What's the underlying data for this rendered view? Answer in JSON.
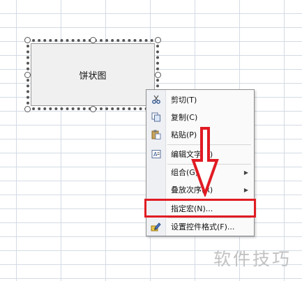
{
  "shape": {
    "label": "饼状图"
  },
  "context_menu": {
    "items": [
      {
        "label": "剪切(T)",
        "icon": "scissors-icon"
      },
      {
        "label": "复制(C)",
        "icon": "copy-icon"
      },
      {
        "label": "粘贴(P)",
        "icon": "paste-icon"
      },
      {
        "label": "编辑文字(X)",
        "icon": "edit-text-icon"
      },
      {
        "label": "组合(G)",
        "has_submenu": true
      },
      {
        "label": "叠放次序(R)",
        "has_submenu": true
      },
      {
        "label": "指定宏(N)...",
        "highlighted": true
      },
      {
        "label": "设置控件格式(F)...",
        "icon": "format-control-icon"
      }
    ]
  },
  "annotation": {
    "highlight_color": "#e11b23"
  },
  "watermark": "软件技巧"
}
